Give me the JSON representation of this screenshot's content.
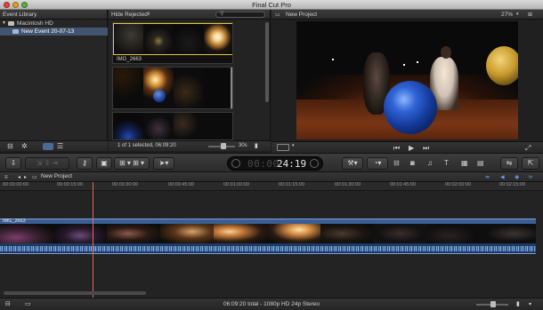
{
  "window": {
    "title": "Final Cut Pro"
  },
  "library": {
    "header": "Event Library",
    "items": [
      {
        "label": "Macintosh HD",
        "selected": false
      },
      {
        "label": "New Event 20-07-13",
        "selected": true
      }
    ]
  },
  "browser": {
    "filter": "Hide Rejected",
    "clip_name": "IMG_2663",
    "status": "1 of 1 selected, 06:09:20",
    "zoom": "30s"
  },
  "viewer": {
    "title": "New Project",
    "zoom": "27%"
  },
  "timecode": {
    "value": "24:19"
  },
  "timeline": {
    "project": "New Project",
    "ticks": [
      "00:00:00:00",
      "00:00:15:00",
      "00:00:30:00",
      "00:00:45:00",
      "00:01:00:00",
      "00:01:15:00",
      "00:01:30:00",
      "00:01:45:00",
      "00:02:00:00",
      "00:02:15:00"
    ],
    "clip_name": "IMG_2663",
    "playhead_fraction": 0.17
  },
  "status_bar": {
    "text": "06:09:20 total - 1080p HD 24p Stereo"
  },
  "colors": {
    "selection": "#41556f",
    "clip_video_header": "#3a5e93",
    "audio_wave": "#4f7fb8",
    "playhead": "#e06a55"
  }
}
